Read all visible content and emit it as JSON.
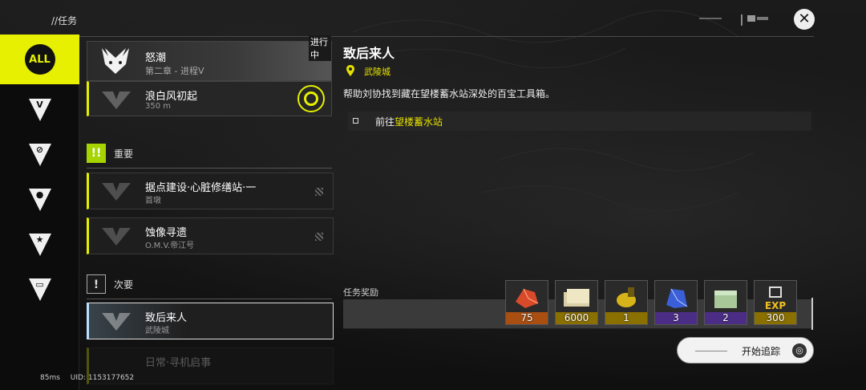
{
  "header": {
    "breadcrumb": "//任务"
  },
  "nav": {
    "all_label": "ALL",
    "items": [
      {
        "icon": "endfield-icon",
        "label": "ENDFIELD"
      },
      {
        "icon": "compass-icon"
      },
      {
        "icon": "person-icon"
      },
      {
        "icon": "star-icon"
      },
      {
        "icon": "vehicle-icon"
      }
    ]
  },
  "list": {
    "chapter": {
      "title": "怒潮",
      "subtitle": "第二章 - 进程V",
      "status": "进行中"
    },
    "active_quest": {
      "title": "浪白风初起",
      "distance": "350 m"
    },
    "sections": [
      {
        "label": "重要",
        "icon_text": "!!",
        "color": "#a6d400"
      },
      {
        "label": "次要",
        "icon_text": "!",
        "color": "#d0d0d0"
      }
    ],
    "important": [
      {
        "title": "据点建设·心脏修缮站·一",
        "location": "首墩"
      },
      {
        "title": "蚀像寻遗",
        "location": "O.M.V.帝江号"
      }
    ],
    "secondary": [
      {
        "title": "致后来人",
        "location": "武陵城"
      },
      {
        "title": "日常·寻机启事",
        "location": ""
      }
    ]
  },
  "detail": {
    "title": "致后来人",
    "location": "武陵城",
    "description": "帮助刘协找到藏在望楼蓄水站深处的百宝工具箱。",
    "objective_prefix": "前往",
    "objective_highlight": "望楼蓄水站",
    "rewards_label": "任务奖励",
    "rewards": [
      {
        "name": "orange-crystal",
        "count": "75"
      },
      {
        "name": "money-bundle",
        "count": "6000"
      },
      {
        "name": "gold-capsule",
        "count": "1"
      },
      {
        "name": "blue-crystal",
        "count": "3"
      },
      {
        "name": "green-crate",
        "count": "2"
      },
      {
        "name": "exp",
        "label": "EXP",
        "count": "300"
      }
    ],
    "track_button": "开始追踪"
  },
  "footer": {
    "ping": "85ms",
    "uid": "UID: 1153177652"
  },
  "colors": {
    "accent": "#e6f000",
    "location": "#e6e000"
  }
}
